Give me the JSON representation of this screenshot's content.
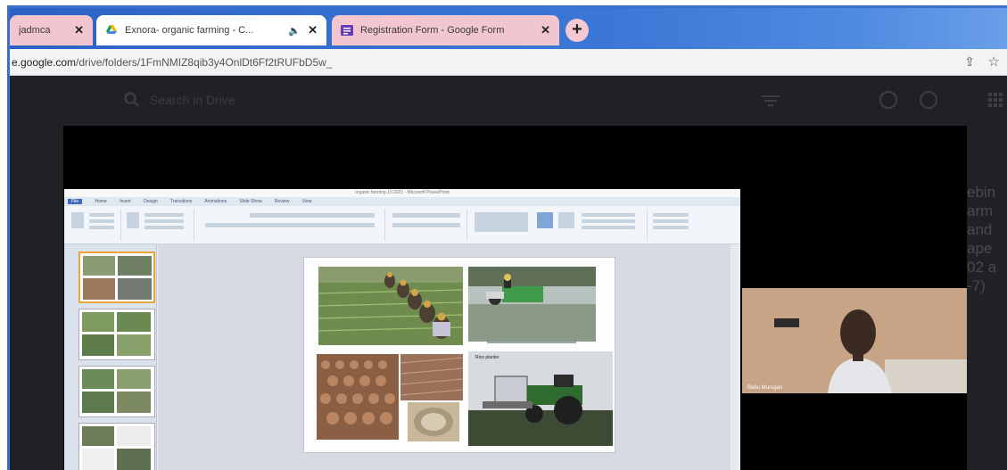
{
  "tabs": [
    {
      "label": "jadmca",
      "favicon": "tab-icon"
    },
    {
      "label": "Exnora- organic farming - C...",
      "favicon": "google-drive-icon",
      "playing_audio": true
    },
    {
      "label": "Registration Form - Google Form",
      "favicon": "google-forms-icon"
    }
  ],
  "new_tab_label": "+",
  "close_glyph": "✕",
  "speaker_glyph": "🔈",
  "address_bar": {
    "host": "e.google.com",
    "path": "/drive/folders/1FmNMIZ8qib3y4OnlDt6Ff2tRUFbD5w_",
    "share_glyph": "⇪",
    "star_glyph": "☆"
  },
  "drive": {
    "search_placeholder": "Search in Drive",
    "side_text_lines": [
      "ebin",
      "arm",
      "and",
      "ape",
      "02 a",
      "-7)"
    ]
  },
  "powerpoint": {
    "window_title": "organic farming 10.2021 - Microsoft PowerPoint",
    "menu_tabs": [
      "File",
      "Home",
      "Insert",
      "Design",
      "Transitions",
      "Animations",
      "Slide Show",
      "Review",
      "View"
    ],
    "slide_photo_label": "Rice planter"
  },
  "webcam": {
    "participant_name": "Babu Murugan"
  },
  "colors": {
    "tab_inactive": "#f1c6ce",
    "tab_active": "#ffffff",
    "tabstrip_accent": "#3b78d6",
    "drive_background": "#202124"
  }
}
